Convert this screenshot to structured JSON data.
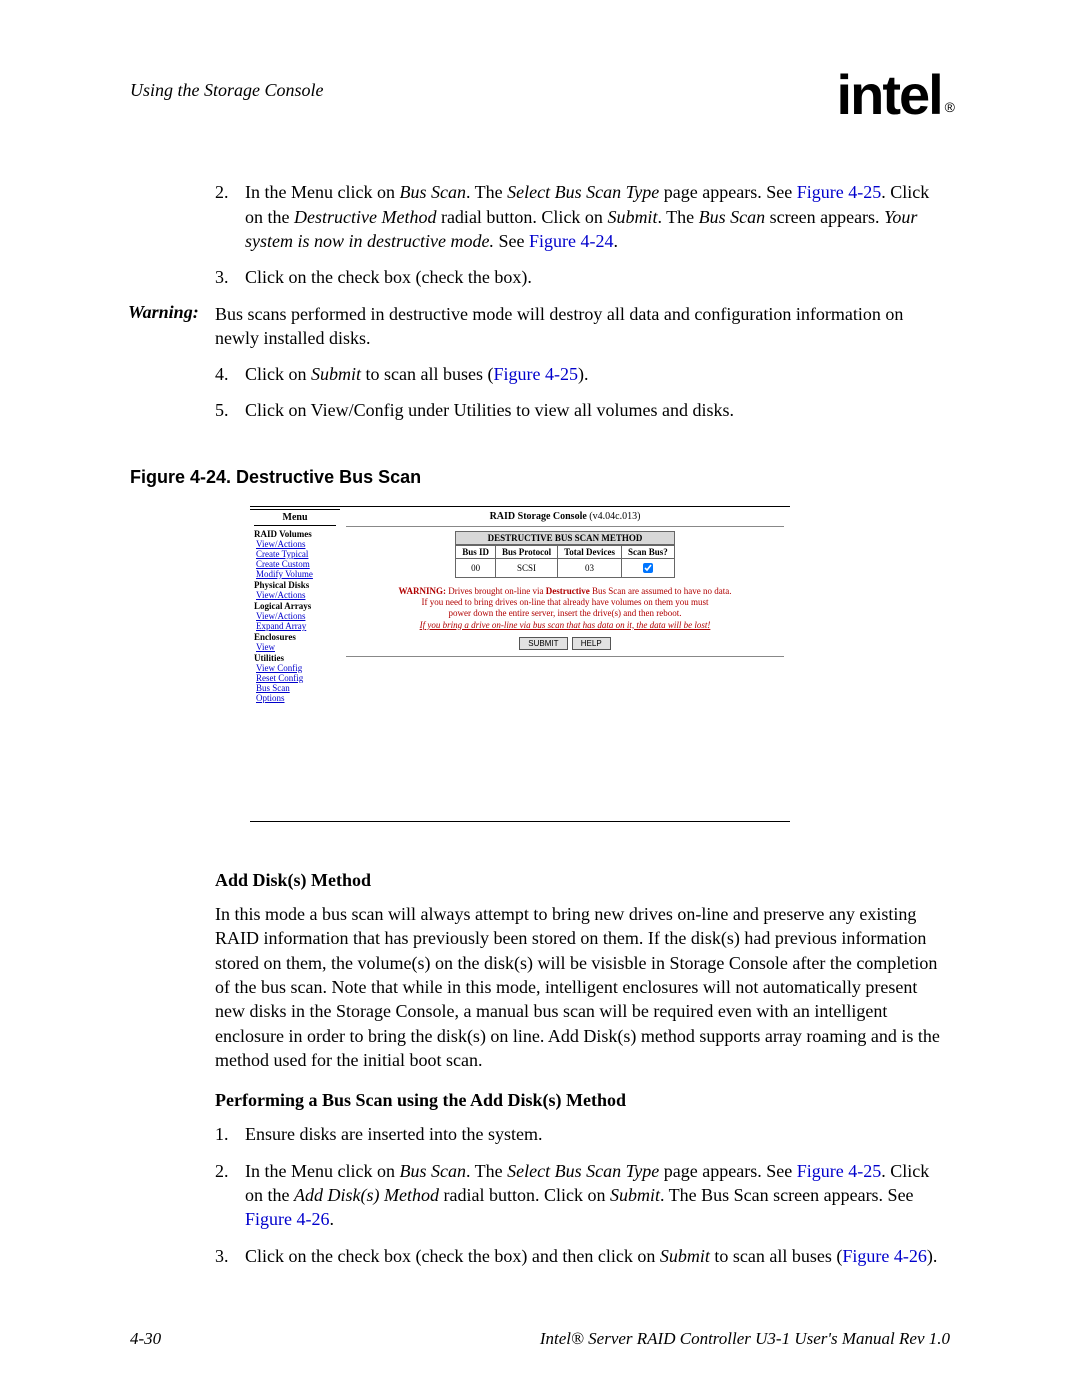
{
  "header": {
    "running_head": "Using the Storage Console",
    "logo_text": "intel",
    "logo_reg": "®"
  },
  "steps_a": {
    "s2_num": "2.",
    "s2_a": "In the Menu click on ",
    "s2_it1": "Bus Scan",
    "s2_b": ". The ",
    "s2_it2": "Select Bus Scan Type",
    "s2_c": " page appears. See ",
    "s2_link": "Figure 4-25",
    "s2_d": ". Click on the ",
    "s2_it3": "Destructive Method",
    "s2_e": " radial button. Click on ",
    "s2_it4": "Submit",
    "s2_f": ". The ",
    "s2_it5": "Bus Scan",
    "s2_g": " screen appears. ",
    "s2_it6": "Your system is now in destructive mode.",
    "s2_h": " See ",
    "s2_link2": "Figure 4-24",
    "s2_i": ".",
    "s3_num": "3.",
    "s3": "Click on the check box (check the box)."
  },
  "warning": {
    "label": "Warning:",
    "text": "Bus scans performed in destructive mode will destroy all data and configuration information on newly installed disks."
  },
  "steps_b": {
    "s4_num": "4.",
    "s4_a": "Click on ",
    "s4_it": "Submit",
    "s4_b": " to scan all buses (",
    "s4_link": "Figure 4-25",
    "s4_c": ").",
    "s5_num": "5.",
    "s5": "Click on View/Config under Utilities to view all volumes and disks."
  },
  "fig_caption": "Figure 4-24. Destructive Bus Scan",
  "figure": {
    "menu_header": "Menu",
    "content_title_a": "RAID Storage Console",
    "content_title_b": " (v4.04c.013)",
    "groups": {
      "g1": "RAID Volumes",
      "g1_l1": "View/Actions",
      "g1_l2": "Create Typical",
      "g1_l3": "Create Custom",
      "g1_l4": "Modify Volume",
      "g2": "Physical Disks",
      "g2_l1": "View/Actions",
      "g3": "Logical Arrays",
      "g3_l1": "View/Actions",
      "g3_l2": "Expand Array",
      "g4": "Enclosures",
      "g4_l1": "View",
      "g5": "Utilities",
      "g5_l1": "View Config",
      "g5_l2": "Reset Config",
      "g5_l3": "Bus Scan",
      "g5_l4": "Options"
    },
    "table": {
      "caption": "DESTRUCTIVE BUS SCAN METHOD",
      "h1": "Bus ID",
      "h2": "Bus Protocol",
      "h3": "Total Devices",
      "h4": "Scan Bus?",
      "r1c1": "00",
      "r1c2": "SCSI",
      "r1c3": "03"
    },
    "warn": {
      "l1a": "WARNING: ",
      "l1b": "Drives brought on-line via ",
      "l1c": "Destructive",
      "l1d": " Bus Scan are assumed to have no data.",
      "l2": "If you need to bring drives on-line that already have volumes on them you must",
      "l3": "power down the entire server, insert the drive(s) and then reboot.",
      "l4": "If you bring a drive on-line via bus scan that has data on it, the data will be lost!"
    },
    "btn_submit": "SUBMIT",
    "btn_help": "HELP"
  },
  "sub1": "Add Disk(s) Method",
  "para1": "In this mode a bus scan will always attempt to bring new drives on-line and preserve any existing RAID information that has previously been stored on them. If the disk(s) had previous information stored on them, the volume(s) on the disk(s) will be visisble in Storage Console after the completion of the bus scan. Note that while in this mode, intelligent enclosures will not automatically present new disks in the Storage Console, a manual bus scan will be required even with an intelligent enclosure in order to bring the disk(s) on line. Add Disk(s) method supports array roaming and is the method used for the initial boot scan.",
  "sub2": "Performing a Bus Scan using the Add Disk(s) Method",
  "steps_c": {
    "s1_num": "1.",
    "s1": "Ensure disks are inserted into the system.",
    "s2_num": "2.",
    "s2_a": "In the Menu click on ",
    "s2_it1": "Bus Scan",
    "s2_b": ". The ",
    "s2_it2": "Select Bus Scan Type",
    "s2_c": " page appears. See ",
    "s2_link": "Figure 4-25",
    "s2_d": ". Click on the ",
    "s2_it3": "Add Disk(s) Method",
    "s2_e": " radial button. Click on ",
    "s2_it4": "Submit",
    "s2_f": ". The Bus Scan screen appears. See ",
    "s2_link2": "Figure 4-26",
    "s2_g": ".",
    "s3_num": "3.",
    "s3_a": "Click on the check box (check the box) and then click on ",
    "s3_it": "Submit",
    "s3_b": " to scan all buses (",
    "s3_link": "Figure 4-26",
    "s3_c": ")."
  },
  "footer": {
    "left": "4-30",
    "right": "Intel® Server RAID Controller U3-1 User's Manual Rev 1.0"
  }
}
